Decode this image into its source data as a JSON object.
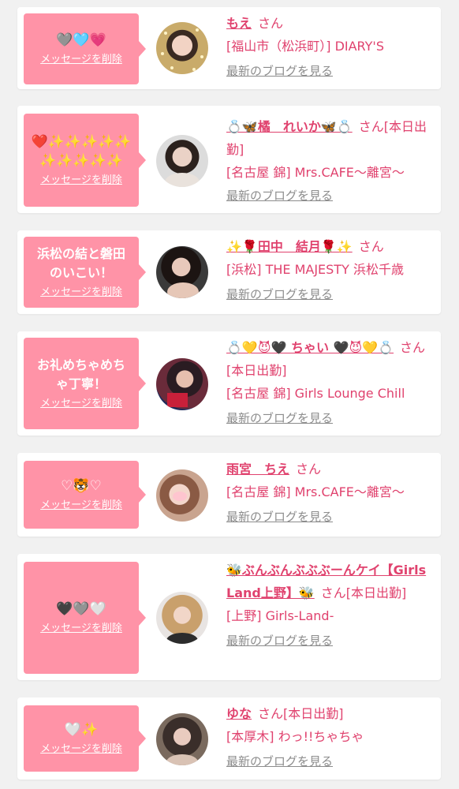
{
  "delete_label": "メッセージを削除",
  "blog_label": "最新のブログを見る",
  "colors": {
    "bubble": "#ff93a7",
    "accent_text": "#e0426e",
    "muted_text": "#8c8c8c",
    "card_bg": "#ffffff",
    "page_bg": "#f1f1f1"
  },
  "entries": [
    {
      "message": "🩶🩵💗",
      "name": "もえ",
      "suffix": "さん",
      "shop": "[福山市（松浜町）] DIARY'S"
    },
    {
      "message": "❤️✨✨✨✨✨✨✨✨✨✨",
      "name": "💍🦋橘　れいか🦋💍",
      "suffix": "さん[本日出勤]",
      "shop": "[名古屋 錦] Mrs.CAFE〜離宮〜"
    },
    {
      "message": "浜松の結と磐田のいこい！",
      "name": "✨🌹田中　結月🌹✨",
      "suffix": "さん",
      "shop": "[浜松] THE MAJESTY 浜松千歳"
    },
    {
      "message": "お礼めちゃめちゃ丁寧！",
      "name": "💍💛😈🖤 ちゃい 🖤😈💛💍",
      "suffix": "さん[本日出勤]",
      "shop": "[名古屋 錦] Girls Lounge Chill"
    },
    {
      "message": "♡🐯♡",
      "name": "雨宮　ちえ",
      "suffix": "さん",
      "shop": "[名古屋 錦] Mrs.CAFE〜離宮〜"
    },
    {
      "message": "🖤🩶🤍",
      "name": "🐝ぶんぶんぶぶぶーんケイ【Girls Land上野】🐝",
      "suffix": "さん[本日出勤]",
      "shop": "[上野] Girls-Land-"
    },
    {
      "message": "🤍✨",
      "name": "ゆな",
      "suffix": "さん[本日出勤]",
      "shop": "[本厚木] わっ!!ちゃちゃ"
    }
  ]
}
